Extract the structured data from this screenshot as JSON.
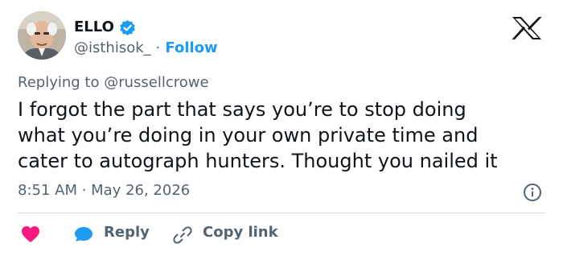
{
  "author": {
    "name": "ELLO",
    "handle": "@isthisok_",
    "separator": "·",
    "follow_label": "Follow"
  },
  "reply_context": "Replying to @russellcrowe",
  "tweet_text": "I forgot the part that says you’re to stop doing\nwhat you’re doing in your own private time and\ncater to autograph hunters. Thought you nailed it",
  "timestamp": "8:51 AM · May 26, 2026",
  "actions": {
    "like_icon": "heart-icon",
    "reply_label": "Reply",
    "copy_link_label": "Copy link"
  },
  "colors": {
    "accent": "#1d9bf0",
    "like": "#f91880",
    "text": "#0f1419",
    "secondary": "#536471"
  }
}
